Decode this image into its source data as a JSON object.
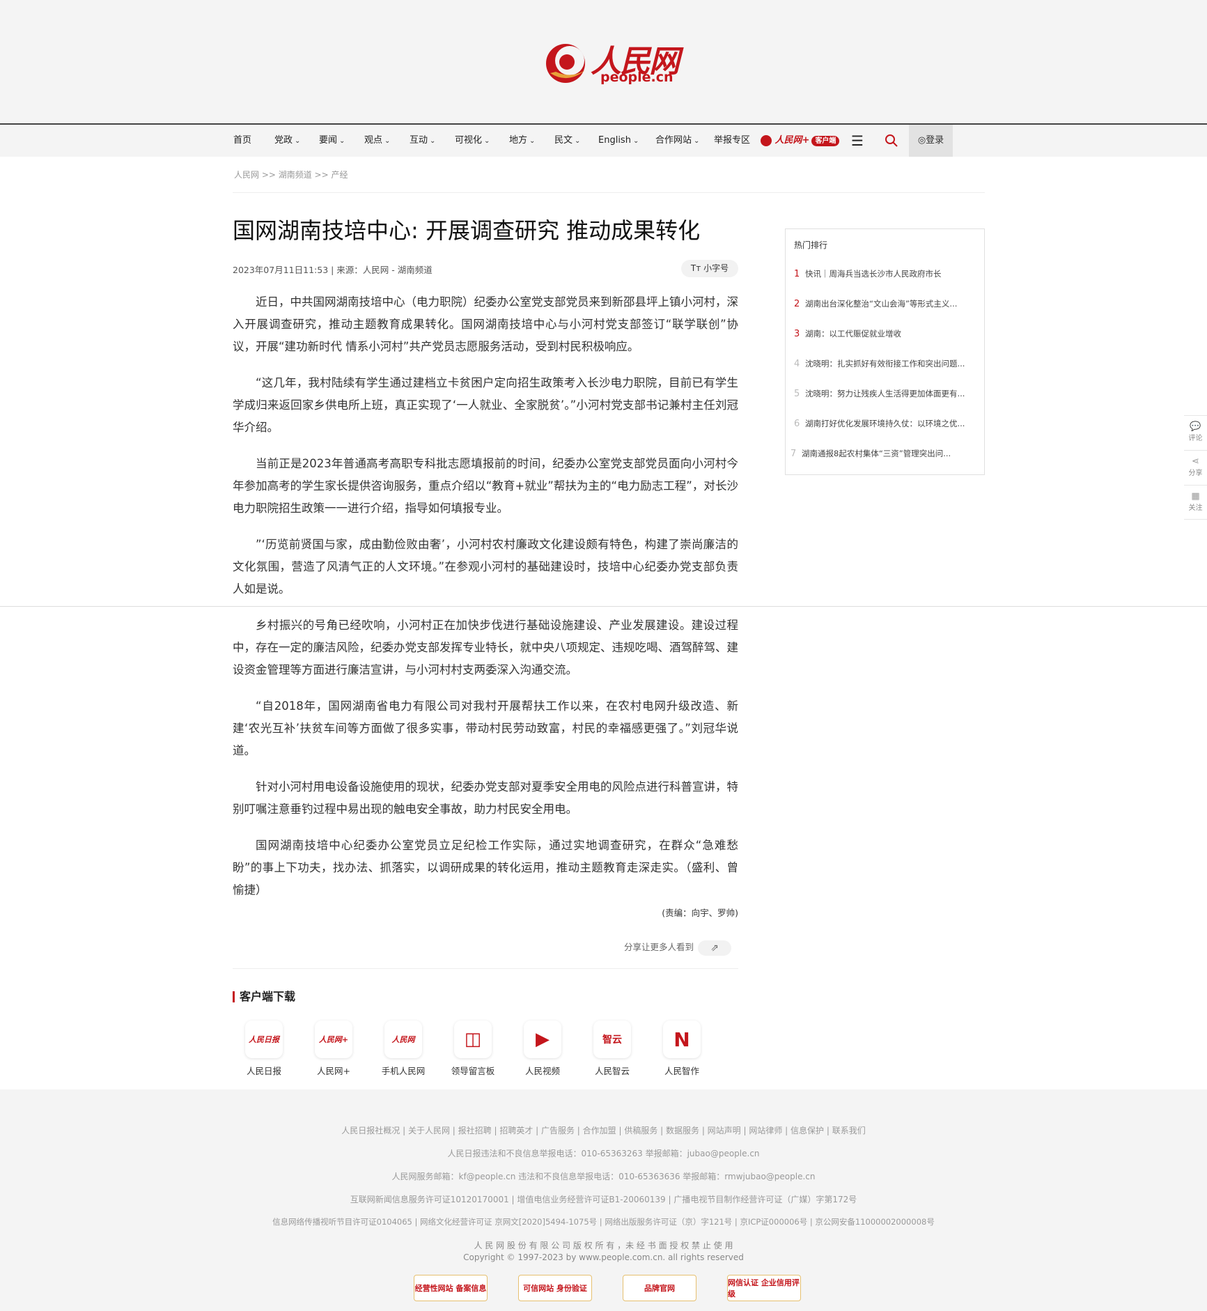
{
  "header": {
    "logo_text": "人民网",
    "logo_domain": "people.cn"
  },
  "nav": {
    "items": [
      {
        "label": "首页",
        "dropdown": false
      },
      {
        "label": "党政",
        "dropdown": true
      },
      {
        "label": "要闻",
        "dropdown": true
      },
      {
        "label": "观点",
        "dropdown": true
      },
      {
        "label": "互动",
        "dropdown": true
      },
      {
        "label": "可视化",
        "dropdown": true
      },
      {
        "label": "地方",
        "dropdown": true
      },
      {
        "label": "民文",
        "dropdown": true
      },
      {
        "label": "English",
        "dropdown": true
      },
      {
        "label": "合作网站",
        "dropdown": true
      },
      {
        "label": "举报专区",
        "dropdown": false
      }
    ],
    "app_label": "人民网+",
    "app_badge": "客户端",
    "login_label": "登录"
  },
  "breadcrumb": "人民网 >> 湖南频道 >> 产经",
  "article": {
    "title": "国网湖南技培中心: 开展调查研究 推动成果转化",
    "meta": "2023年07月11日11:53 | 来源：人民网 - 湖南频道",
    "font_size_btn": "小字号",
    "paragraphs": [
      "近日，中共国网湖南技培中心（电力职院）纪委办公室党支部党员来到新邵县坪上镇小河村，深入开展调查研究，推动主题教育成果转化。国网湖南技培中心与小河村党支部签订“联学联创”协议，开展“建功新时代 情系小河村”共产党员志愿服务活动，受到村民积极响应。",
      "“这几年，我村陆续有学生通过建档立卡贫困户定向招生政策考入长沙电力职院，目前已有学生学成归来返回家乡供电所上班，真正实现了‘一人就业、全家脱贫’。”小河村党支部书记兼村主任刘冠华介绍。",
      "当前正是2023年普通高考高职专科批志愿填报前的时间，纪委办公室党支部党员面向小河村今年参加高考的学生家长提供咨询服务，重点介绍以“教育+就业”帮扶为主的“电力励志工程”，对长沙电力职院招生政策一一进行介绍，指导如何填报专业。",
      "”‘历览前贤国与家，成由勤俭败由奢’，小河村农村廉政文化建设颇有特色，构建了崇尚廉洁的文化氛围，营造了风清气正的人文环境。”在参观小河村的基础建设时，技培中心纪委办党支部负责人如是说。",
      "乡村振兴的号角已经吹响，小河村正在加快步伐进行基础设施建设、产业发展建设。建设过程中，存在一定的廉洁风险，纪委办党支部发挥专业特长，就中央八项规定、违规吃喝、酒驾醉驾、建设资金管理等方面进行廉洁宣讲，与小河村村支两委深入沟通交流。",
      "“自2018年，国网湖南省电力有限公司对我村开展帮扶工作以来，在农村电网升级改造、新建‘农光互补’扶贫车间等方面做了很多实事，带动村民劳动致富，村民的幸福感更强了。”刘冠华说道。",
      "针对小河村用电设备设施使用的现状，纪委办党支部对夏季安全用电的风险点进行科普宣讲，特别叮嘱注意垂钓过程中易出现的触电安全事故，助力村民安全用电。",
      "国网湖南技培中心纪委办公室党员立足纪检工作实际，通过实地调查研究，在群众“急难愁盼”的事上下功夫，找办法、抓落实，以调研成果的转化运用，推动主题教育走深走实。（盛利、曾愉捷）"
    ],
    "editor": "(责编：向宇、罗帅)",
    "share_text": "分享让更多人看到"
  },
  "sidebar": {
    "title": "热门排行",
    "items": [
      {
        "num": "1",
        "text": "快讯｜周海兵当选长沙市人民政府市长"
      },
      {
        "num": "2",
        "text": "湖南出台深化整治“文山会海”等形式主义..."
      },
      {
        "num": "3",
        "text": "湖南：以工代赈促就业增收"
      },
      {
        "num": "4",
        "text": "沈晓明：扎实抓好有效衔接工作和突出问题..."
      },
      {
        "num": "5",
        "text": "沈晓明：努力让残疾人生活得更加体面更有..."
      },
      {
        "num": "6",
        "text": "湖南打好优化发展环境持久仗：以环境之优..."
      },
      {
        "num": "7",
        "text": "湖南通报8起农村集体“三资”管理突出问..."
      }
    ]
  },
  "floatbar": {
    "items": [
      {
        "icon": "comment-icon",
        "label": "评论"
      },
      {
        "icon": "share-icon",
        "label": "分享"
      },
      {
        "icon": "follow-icon",
        "label": "关注"
      }
    ]
  },
  "downloads": {
    "title": "客户端下载",
    "apps": [
      {
        "label": "人民日报",
        "logo_text": "人民日报"
      },
      {
        "label": "人民网+",
        "logo_text": "人民网+"
      },
      {
        "label": "手机人民网",
        "logo_text": "人民网"
      },
      {
        "label": "领导留言板",
        "logo_text": "◫"
      },
      {
        "label": "人民视频",
        "logo_text": "▶"
      },
      {
        "label": "人民智云",
        "logo_text": "智云"
      },
      {
        "label": "人民智作",
        "logo_text": "N"
      }
    ]
  },
  "footer": {
    "links": "人民日报社概况  |  关于人民网  |  报社招聘  |  招聘英才  |  广告服务  |  合作加盟  |  供稿服务  |  数据服务  |  网站声明  |  网站律师  |  信息保护  |  联系我们",
    "line2": "人民日报违法和不良信息举报电话：010-65363263    举报邮箱：jubao@people.cn",
    "line3": "人民网服务邮箱：kf@people.cn    违法和不良信息举报电话：010-65363636    举报邮箱：rmwjubao@people.cn",
    "line4": "互联网新闻信息服务许可证10120170001  |  增值电信业务经营许可证B1-20060139  |  广播电视节目制作经营许可证（广媒）字第172号",
    "line5": "信息网络传播视听节目许可证0104065 | 网络文化经营许可证 京网文[2020]5494-1075号 | 网络出版服务许可证（京）字121号 | 京ICP证000006号 | 京公网安备11000002000008号",
    "line6": "人 民 网 股 份 有 限 公 司 版 权 所 有 ，未 经 书 面 授 权 禁 止 使 用",
    "line7": "Copyright © 1997-2023 by www.people.com.cn. all rights reserved",
    "badges": [
      "经营性网站 备案信息",
      "可信网站 身份验证",
      "品牌官网",
      "网信认证 企业信用评级"
    ]
  }
}
